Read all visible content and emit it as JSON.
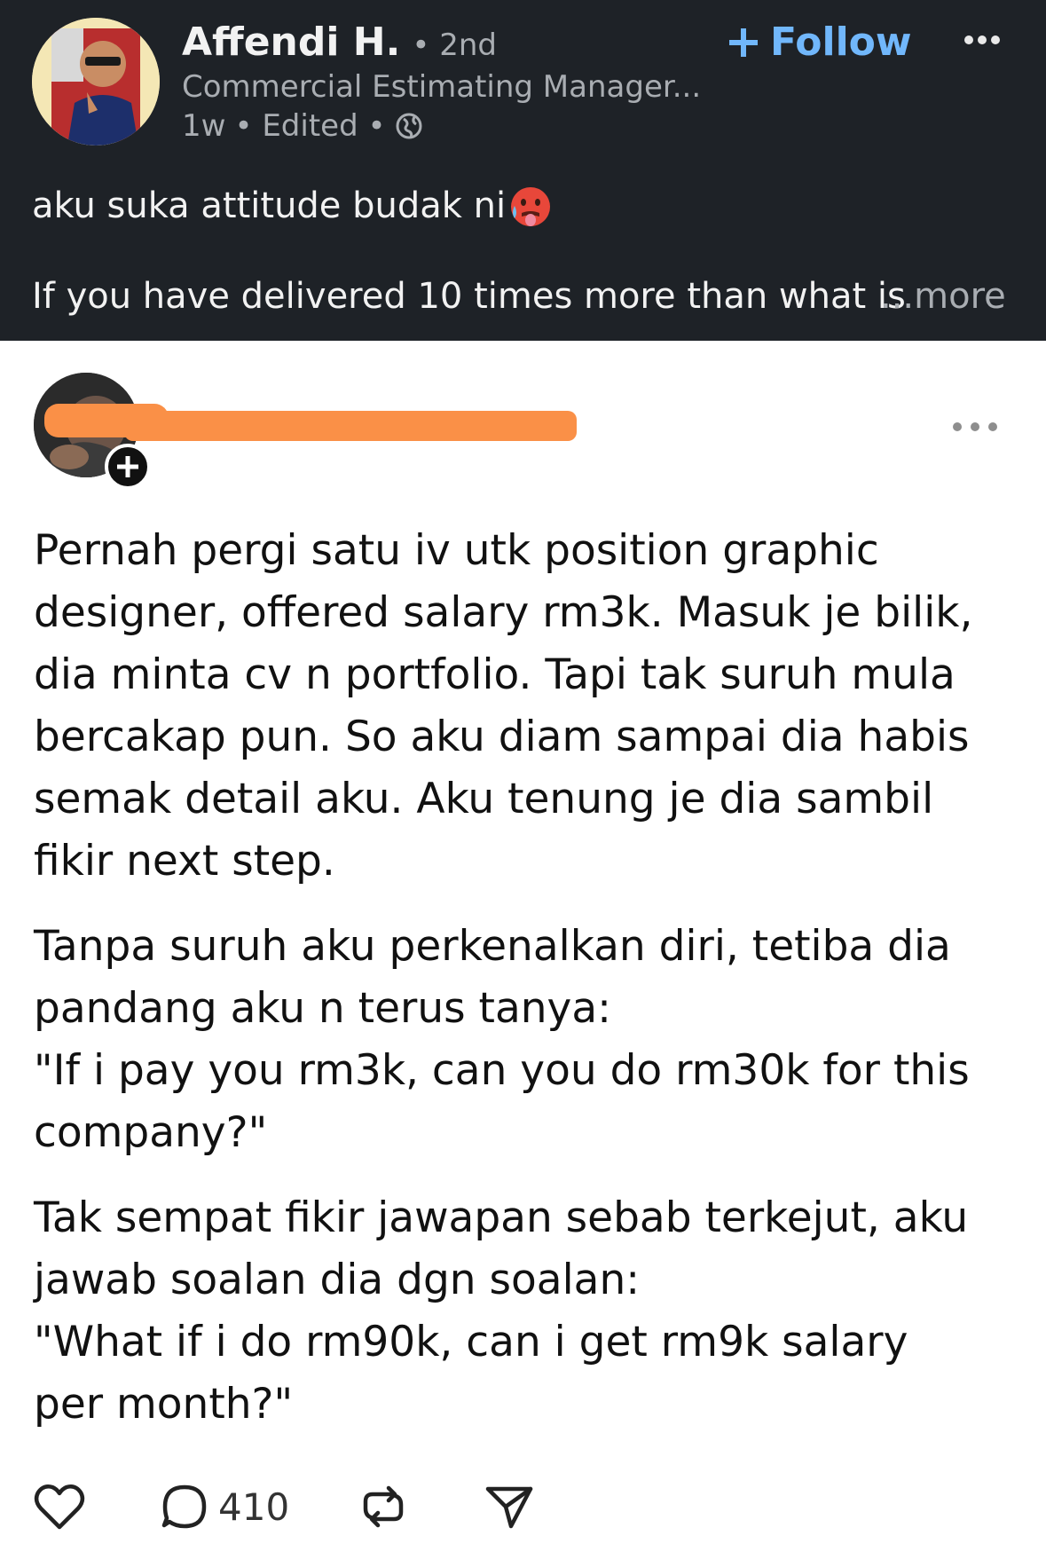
{
  "linkedin_post": {
    "author": {
      "name": "Affendi H.",
      "degree": "• 2nd",
      "headline": "Commercial Estimating Manager...",
      "time": "1w",
      "edited": "• Edited •"
    },
    "follow_label": "Follow",
    "caption": "aku suka attitude budak ni",
    "caption_emoji": "hot-face-emoji",
    "body_preview": "If you have delivered 10 times more than what is",
    "see_more_label": "...more"
  },
  "threads_post": {
    "paragraphs": [
      {
        "lines": [
          "Pernah pergi satu iv utk position graphic",
          "designer, offered salary rm3k. Masuk je bilik,",
          "dia minta cv n portfolio. Tapi tak suruh mula",
          "bercakap pun. So aku diam sampai dia habis",
          "semak detail aku. Aku tenung je dia sambil",
          "fikir next step."
        ]
      },
      {
        "lines": [
          "Tanpa suruh aku perkenalkan diri, tetiba dia",
          "pandang aku n terus tanya:",
          "\"If i pay you rm3k, can you do rm30k for this",
          "company?\""
        ]
      },
      {
        "lines": [
          "Tak sempat fikir jawapan sebab terkejut, aku",
          "jawab soalan dia dgn soalan:",
          "\"What if i do rm90k, can i get rm9k salary",
          "per month?\""
        ]
      }
    ],
    "reply_count": "410"
  },
  "icons": {
    "follow": "plus-icon",
    "visibility": "globe-icon",
    "menu": "more-dots-icon",
    "like": "heart-icon",
    "reply": "speech-bubble-icon",
    "repost": "repost-icon",
    "share": "paper-plane-icon"
  },
  "colors": {
    "header_bg": "#1e2227",
    "follow_blue": "#71b7fb",
    "redaction_orange": "#fa9047"
  }
}
